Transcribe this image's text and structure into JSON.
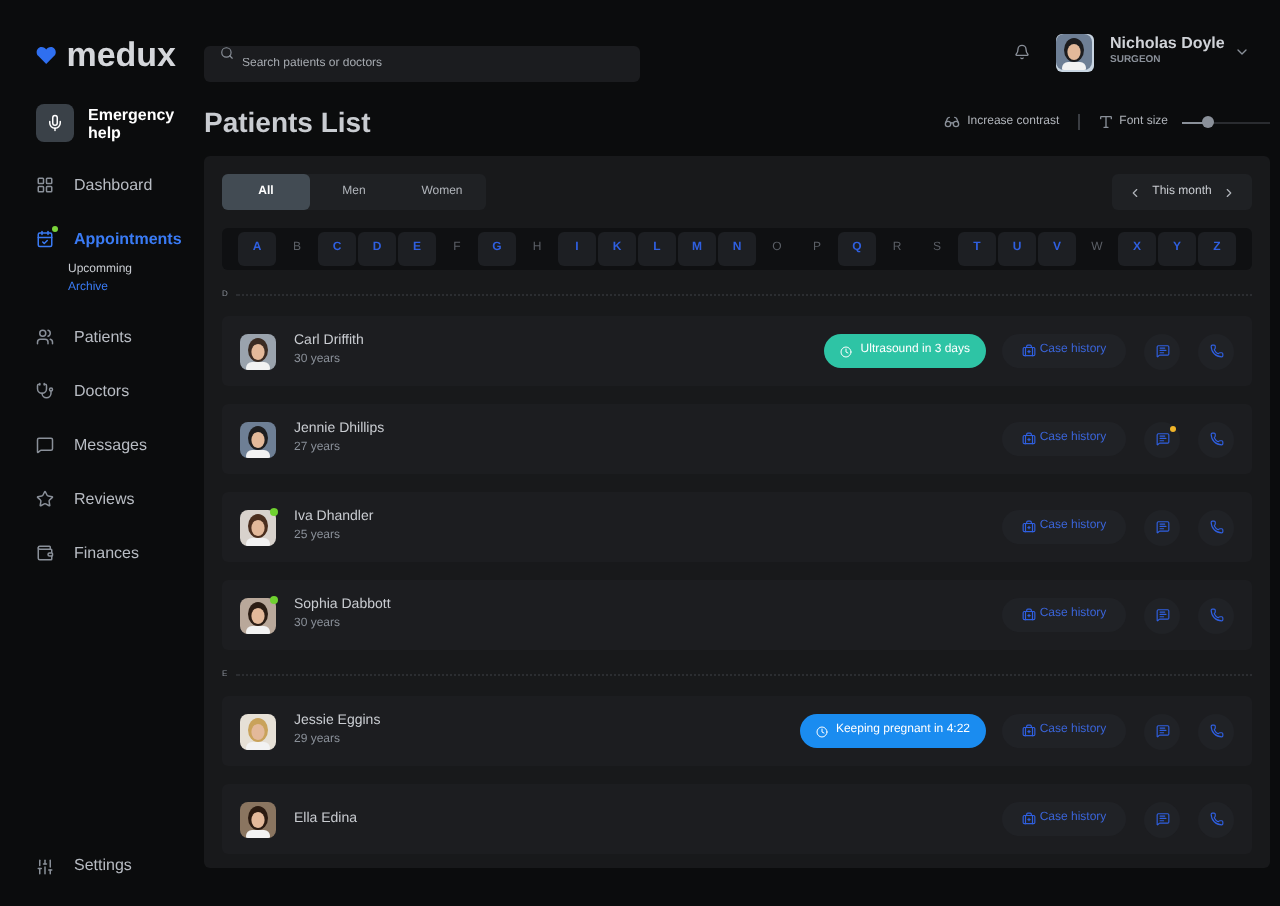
{
  "logo": {
    "text": "medux"
  },
  "search": {
    "placeholder": "Search patients or doctors"
  },
  "user": {
    "name": "Nicholas Doyle",
    "role": "SURGEON"
  },
  "emergency": {
    "label": "Emergency help"
  },
  "nav": [
    {
      "label": "Dashboard",
      "selected": false,
      "dot": false
    },
    {
      "label": "Appointments",
      "selected": true,
      "dot": true,
      "children": [
        {
          "label": "Upcomming",
          "selected": false
        },
        {
          "label": "Archive",
          "selected": true
        }
      ]
    },
    {
      "label": "Patients",
      "selected": false,
      "dot": false
    },
    {
      "label": "Doctors",
      "selected": false,
      "dot": false
    },
    {
      "label": "Messages",
      "selected": false,
      "dot": false
    },
    {
      "label": "Reviews",
      "selected": false,
      "dot": false
    },
    {
      "label": "Finances",
      "selected": false,
      "dot": false
    }
  ],
  "settings": {
    "label": "Settings"
  },
  "title": "Patients List",
  "contrast": {
    "label": "Increase contrast"
  },
  "font_size": {
    "label": "Font size",
    "level": 0.3
  },
  "tabs": [
    {
      "label": "All",
      "selected": true
    },
    {
      "label": "Men",
      "selected": false
    },
    {
      "label": "Women",
      "selected": false
    }
  ],
  "period": {
    "label": "This month"
  },
  "alphabet": [
    {
      "letter": "A",
      "available": true
    },
    {
      "letter": "B",
      "available": false
    },
    {
      "letter": "C",
      "available": true
    },
    {
      "letter": "D",
      "available": true
    },
    {
      "letter": "E",
      "available": true
    },
    {
      "letter": "F",
      "available": false
    },
    {
      "letter": "G",
      "available": true
    },
    {
      "letter": "H",
      "available": false
    },
    {
      "letter": "I",
      "available": true
    },
    {
      "letter": "K",
      "available": true
    },
    {
      "letter": "L",
      "available": true
    },
    {
      "letter": "M",
      "available": true
    },
    {
      "letter": "N",
      "available": true
    },
    {
      "letter": "O",
      "available": false
    },
    {
      "letter": "P",
      "available": false
    },
    {
      "letter": "Q",
      "available": true
    },
    {
      "letter": "R",
      "available": false
    },
    {
      "letter": "S",
      "available": false
    },
    {
      "letter": "T",
      "available": true
    },
    {
      "letter": "U",
      "available": true
    },
    {
      "letter": "V",
      "available": true
    },
    {
      "letter": "W",
      "available": false
    },
    {
      "letter": "X",
      "available": true
    },
    {
      "letter": "Y",
      "available": true
    },
    {
      "letter": "Z",
      "available": true
    }
  ],
  "sections": [
    {
      "letter": "D",
      "patients": [
        {
          "name": "Carl Driffith",
          "age": "30 years",
          "online": false,
          "unread": false,
          "badge": {
            "text": "Ultrasound in 3 days",
            "color": "#2ec4a5"
          },
          "history": "Case history"
        },
        {
          "name": "Jennie Dhillips",
          "age": "27 years",
          "online": false,
          "unread": true,
          "history": "Case history"
        },
        {
          "name": "Iva Dhandler",
          "age": "25 years",
          "online": true,
          "unread": false,
          "history": "Case history"
        },
        {
          "name": "Sophia Dabbott",
          "age": "30 years",
          "online": true,
          "unread": false,
          "history": "Case history"
        }
      ]
    },
    {
      "letter": "E",
      "patients": [
        {
          "name": "Jessie Eggins",
          "age": "29 years",
          "online": false,
          "unread": false,
          "badge": {
            "text": "Keeping pregnant in 4:22",
            "color": "#1a8cf0"
          },
          "history": "Case history"
        },
        {
          "name": "Ella Edina",
          "online": false,
          "unread": false,
          "history": "Case history"
        }
      ]
    }
  ]
}
